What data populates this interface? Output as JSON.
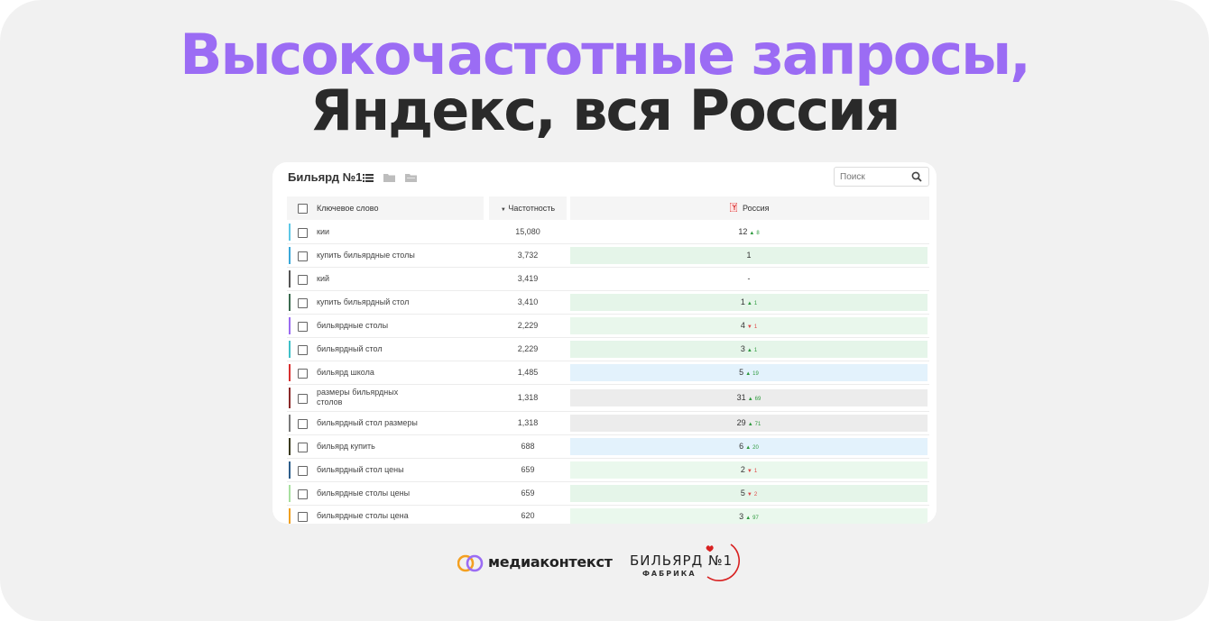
{
  "headline": {
    "line1": "Высокочастотные запросы,",
    "line2": "Яндекс, вся Россия"
  },
  "toolbar": {
    "project_name": "Бильярд №1",
    "search_placeholder": "Поиск"
  },
  "table": {
    "columns": {
      "keyword": "Ключевое слово",
      "frequency": "Частотность",
      "region": "Россия"
    },
    "rows": [
      {
        "keyword": "кии",
        "frequency": "15,080",
        "position": "12",
        "change": "8",
        "direction": "up",
        "stripe": "#5ec8e6",
        "bg": "#ffffff"
      },
      {
        "keyword": "купить бильярдные столы",
        "frequency": "3,732",
        "position": "1",
        "change": "",
        "direction": "",
        "stripe": "#3aa7d8",
        "bg": "#e5f5e9"
      },
      {
        "keyword": "кий",
        "frequency": "3,419",
        "position": "-",
        "change": "",
        "direction": "",
        "stripe": "#555555",
        "bg": "#ffffff"
      },
      {
        "keyword": "купить бильярдный стол",
        "frequency": "3,410",
        "position": "1",
        "change": "1",
        "direction": "up",
        "stripe": "#3c6b4f",
        "bg": "#e5f5e9"
      },
      {
        "keyword": "бильярдные столы",
        "frequency": "2,229",
        "position": "4",
        "change": "1",
        "direction": "down",
        "stripe": "#9a6cf0",
        "bg": "#e9f7ec"
      },
      {
        "keyword": "бильярдный стол",
        "frequency": "2,229",
        "position": "3",
        "change": "1",
        "direction": "up",
        "stripe": "#3fc0c8",
        "bg": "#e5f5e9"
      },
      {
        "keyword": "бильярд школа",
        "frequency": "1,485",
        "position": "5",
        "change": "19",
        "direction": "up",
        "stripe": "#d83030",
        "bg": "#e3f2fc"
      },
      {
        "keyword": "размеры бильярдных столов",
        "frequency": "1,318",
        "position": "31",
        "change": "69",
        "direction": "up",
        "stripe": "#8a2a2a",
        "bg": "#ececec"
      },
      {
        "keyword": "бильярдный стол размеры",
        "frequency": "1,318",
        "position": "29",
        "change": "71",
        "direction": "up",
        "stripe": "#7a7a7a",
        "bg": "#ececec"
      },
      {
        "keyword": "бильярд купить",
        "frequency": "688",
        "position": "6",
        "change": "20",
        "direction": "up",
        "stripe": "#3a3a1e",
        "bg": "#e3f2fc"
      },
      {
        "keyword": "бильярдный стол цены",
        "frequency": "659",
        "position": "2",
        "change": "1",
        "direction": "down",
        "stripe": "#2e5e8a",
        "bg": "#eaf8ed"
      },
      {
        "keyword": "бильярдные столы цены",
        "frequency": "659",
        "position": "5",
        "change": "2",
        "direction": "down",
        "stripe": "#a8e0a0",
        "bg": "#e5f5e9"
      },
      {
        "keyword": "бильярдные столы цена",
        "frequency": "620",
        "position": "3",
        "change": "97",
        "direction": "up",
        "stripe": "#f0a020",
        "bg": "#eaf8ed"
      }
    ]
  },
  "footer": {
    "brand1": "медиаконтекст",
    "brand2": "БИЛЬЯРД №1",
    "brand2_sub": "ФАБРИКА"
  },
  "colors": {
    "accent": "#9b6cf4",
    "dark": "#2a2a2a",
    "up": "#2e9a3e",
    "down": "#e04848"
  }
}
